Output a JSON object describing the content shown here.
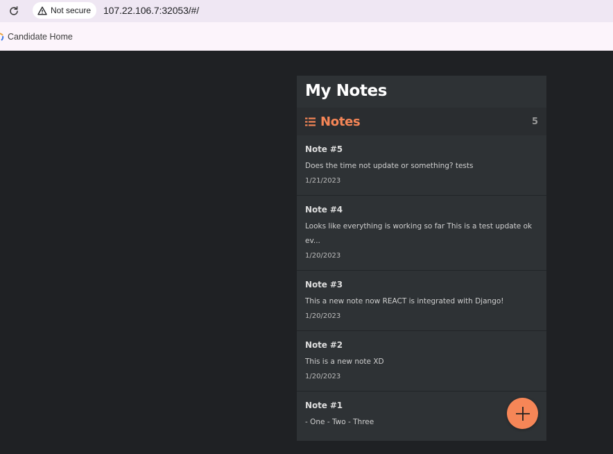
{
  "browser": {
    "security_label": "Not secure",
    "url": "107.22.106.7:32053/#/",
    "bookmarks": [
      {
        "label": "Candidate Home"
      }
    ]
  },
  "app": {
    "title": "My Notes",
    "notes_header": {
      "label": "Notes",
      "count": "5",
      "icon": "list-icon"
    },
    "notes": [
      {
        "title": "Note #5",
        "body": "Does the time not update or something? tests",
        "date": "1/21/2023"
      },
      {
        "title": "Note #4",
        "body": "Looks like everything is working so far This is a test update ok ev...",
        "date": "1/20/2023"
      },
      {
        "title": "Note #3",
        "body": "This a new note now REACT is integrated with Django!",
        "date": "1/20/2023"
      },
      {
        "title": "Note #2",
        "body": "This is a new note XD",
        "date": "1/20/2023"
      },
      {
        "title": "Note #1",
        "body": "- One - Two - Three",
        "date": ""
      }
    ],
    "add_button_icon": "plus-icon",
    "colors": {
      "accent": "#f68657",
      "page_background": "#1f2124",
      "panel_background": "#2e3235"
    }
  }
}
